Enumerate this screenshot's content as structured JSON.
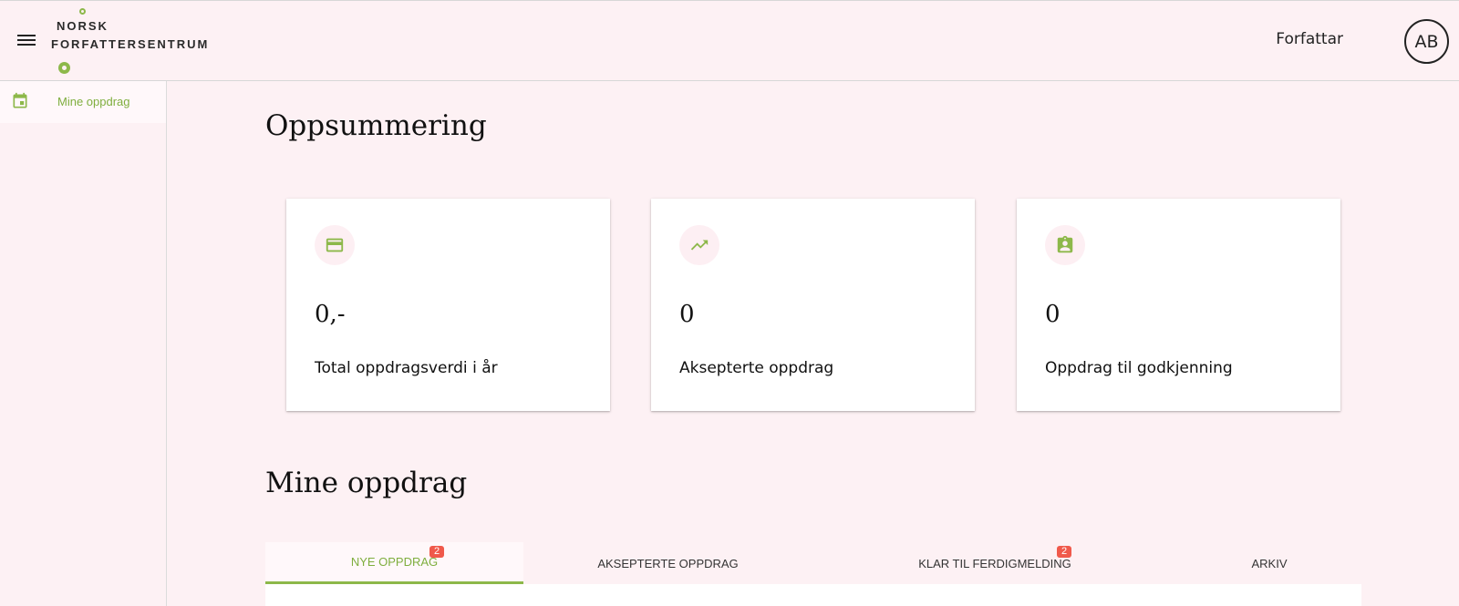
{
  "header": {
    "logo_line1": "NORSK",
    "logo_line2": "FORFATTERSENTRUM",
    "user_name": "Forfattar",
    "avatar_initials": "AB"
  },
  "sidebar": {
    "items": [
      {
        "label": "Mine oppdrag",
        "icon": "calendar-icon"
      }
    ]
  },
  "summary": {
    "title": "Oppsummering",
    "cards": [
      {
        "icon": "credit-card-icon",
        "value": "0,-",
        "label": "Total oppdragsverdi i år"
      },
      {
        "icon": "trending-up-icon",
        "value": "0",
        "label": "Aksepterte oppdrag"
      },
      {
        "icon": "assignment-ind-icon",
        "value": "0",
        "label": "Oppdrag til godkjenning"
      }
    ]
  },
  "assignments": {
    "title": "Mine oppdrag",
    "tabs": [
      {
        "label": "NYE OPPDRAG",
        "badge": "2",
        "active": true
      },
      {
        "label": "AKSEPTERTE OPPDRAG",
        "badge": "",
        "active": false
      },
      {
        "label": "KLAR TIL FERDIGMELDING",
        "badge": "2",
        "active": false
      },
      {
        "label": "ARKIV",
        "badge": "",
        "active": false
      }
    ]
  },
  "colors": {
    "accent": "#8db84a",
    "background": "#fdf1f4",
    "badge": "#f0594b"
  }
}
